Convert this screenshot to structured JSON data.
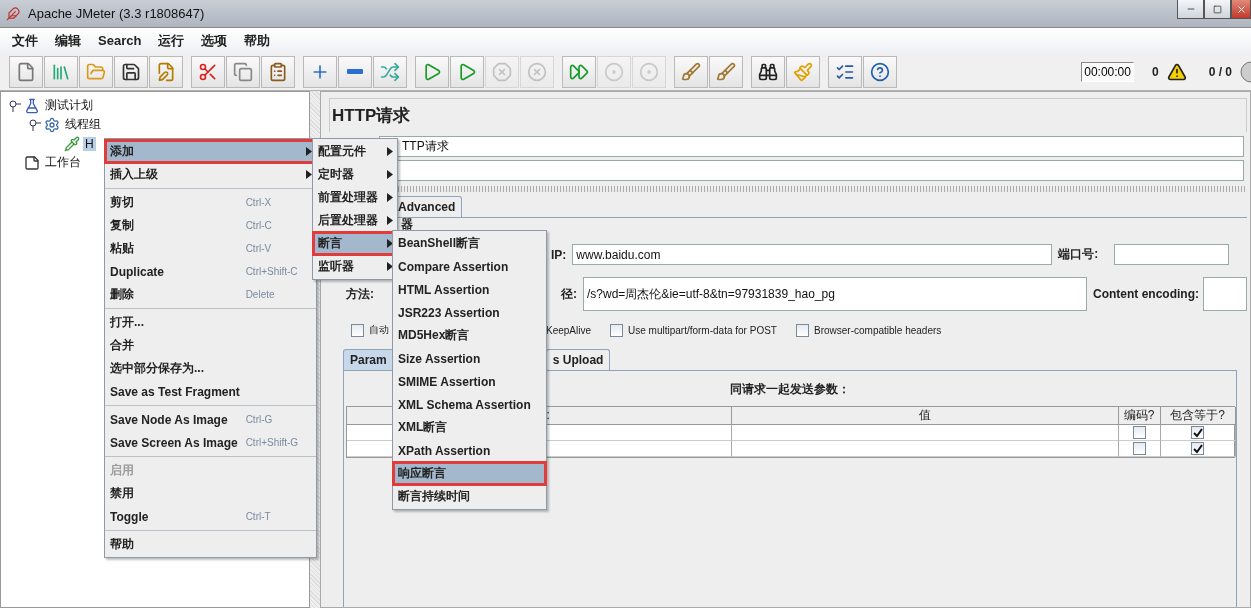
{
  "window": {
    "title": "Apache JMeter (3.3 r1808647)"
  },
  "menu_bar": [
    "文件",
    "编辑",
    "Search",
    "运行",
    "选项",
    "帮助"
  ],
  "toolbar_groups": [
    [
      {
        "kind": "new",
        "disabled": false
      },
      {
        "kind": "templates",
        "disabled": false
      },
      {
        "kind": "open",
        "disabled": false
      },
      {
        "kind": "save",
        "disabled": false
      },
      {
        "kind": "save-as",
        "disabled": false
      }
    ],
    [
      {
        "kind": "cut",
        "disabled": false
      },
      {
        "kind": "copy",
        "disabled": false
      },
      {
        "kind": "paste",
        "disabled": false
      }
    ],
    [
      {
        "kind": "expand",
        "disabled": false
      },
      {
        "kind": "collapse",
        "disabled": false
      },
      {
        "kind": "toggle",
        "disabled": false
      }
    ],
    [
      {
        "kind": "start",
        "disabled": false
      },
      {
        "kind": "start-no-pause",
        "disabled": false
      },
      {
        "kind": "stop",
        "disabled": true
      },
      {
        "kind": "shutdown",
        "disabled": true
      }
    ],
    [
      {
        "kind": "remote-start",
        "disabled": false
      },
      {
        "kind": "remote-stop",
        "disabled": true
      },
      {
        "kind": "remote-exit",
        "disabled": true
      }
    ],
    [
      {
        "kind": "clear",
        "disabled": false
      },
      {
        "kind": "clear-all",
        "disabled": false
      }
    ],
    [
      {
        "kind": "search",
        "disabled": false
      },
      {
        "kind": "reset-search",
        "disabled": false
      }
    ],
    [
      {
        "kind": "functions",
        "disabled": false
      },
      {
        "kind": "help",
        "disabled": false
      }
    ]
  ],
  "status": {
    "timer": "00:00:00",
    "errors": "0",
    "threads": "0 / 0"
  },
  "tree": [
    {
      "label": "测试计划",
      "kind": "plan",
      "expanded": true,
      "selected": false,
      "children": [
        {
          "label": "线程组",
          "kind": "thread-group",
          "expanded": true,
          "selected": false,
          "children": [
            {
              "label": "H",
              "kind": "sampler",
              "selected": true
            }
          ]
        }
      ]
    },
    {
      "label": "工作台",
      "kind": "workbench",
      "selected": false
    }
  ],
  "editor": {
    "title": "HTTP请求",
    "name_value": "TTP请求",
    "tabs": [
      {
        "label": "Advanced",
        "selected": false
      }
    ],
    "server_legend": "器",
    "server_label": "IP:",
    "server_value": "www.baidu.com",
    "port_label": "端口号:",
    "method_label": "方法:",
    "path_label": "径:",
    "path_value": "/s?wd=周杰伦&ie=utf-8&tn=97931839_hao_pg",
    "encoding_label": "Content encoding:",
    "options": [
      {
        "kind": "checkbox",
        "label": "自动",
        "checked": false
      },
      {
        "kind": "text",
        "label": "KeepAlive"
      },
      {
        "kind": "checkbox",
        "label": "Use multipart/form-data for POST",
        "checked": false
      },
      {
        "kind": "checkbox",
        "label": "Browser-compatible headers",
        "checked": false
      }
    ],
    "param_tabs": [
      {
        "label": "Param",
        "selected": true
      },
      {
        "label": "s Upload",
        "selected": false
      }
    ],
    "params_caption": "同请求一起发送参数：",
    "columns": [
      ":",
      "值",
      "编码?",
      "包含等于?"
    ],
    "rows": [
      {
        "encode": false,
        "include_equals": true
      },
      {
        "encode": false,
        "include_equals": true
      }
    ]
  },
  "context_menu": [
    {
      "kind": "item",
      "label": "添加",
      "submenu": true,
      "selected": true,
      "disabled": false
    },
    {
      "kind": "item",
      "label": "插入上级",
      "submenu": true,
      "selected": false,
      "disabled": false
    },
    {
      "kind": "separator"
    },
    {
      "kind": "item",
      "label": "剪切",
      "shortcut": "Ctrl-X",
      "selected": false,
      "disabled": false
    },
    {
      "kind": "item",
      "label": "复制",
      "shortcut": "Ctrl-C",
      "selected": false,
      "disabled": false
    },
    {
      "kind": "item",
      "label": "粘贴",
      "shortcut": "Ctrl-V",
      "selected": false,
      "disabled": false
    },
    {
      "kind": "item",
      "label": "Duplicate",
      "shortcut": "Ctrl+Shift-C",
      "selected": false,
      "disabled": false
    },
    {
      "kind": "item",
      "label": "删除",
      "shortcut": "Delete",
      "selected": false,
      "disabled": false
    },
    {
      "kind": "separator"
    },
    {
      "kind": "item",
      "label": "打开...",
      "selected": false,
      "disabled": false
    },
    {
      "kind": "item",
      "label": "合并",
      "selected": false,
      "disabled": false
    },
    {
      "kind": "item",
      "label": "选中部分保存为...",
      "selected": false,
      "disabled": false
    },
    {
      "kind": "item",
      "label": "Save as Test Fragment",
      "selected": false,
      "disabled": false
    },
    {
      "kind": "separator"
    },
    {
      "kind": "item",
      "label": "Save Node As Image",
      "shortcut": "Ctrl-G",
      "selected": false,
      "disabled": false
    },
    {
      "kind": "item",
      "label": "Save Screen As Image",
      "shortcut": "Ctrl+Shift-G",
      "selected": false,
      "disabled": false
    },
    {
      "kind": "separator"
    },
    {
      "kind": "item",
      "label": "启用",
      "selected": false,
      "disabled": true
    },
    {
      "kind": "item",
      "label": "禁用",
      "selected": false,
      "disabled": false
    },
    {
      "kind": "item",
      "label": "Toggle",
      "shortcut": "Ctrl-T",
      "selected": false,
      "disabled": false
    },
    {
      "kind": "separator"
    },
    {
      "kind": "item",
      "label": "帮助",
      "selected": false,
      "disabled": false
    }
  ],
  "add_submenu": [
    {
      "kind": "item",
      "label": "配置元件",
      "submenu": true,
      "selected": false,
      "disabled": false
    },
    {
      "kind": "item",
      "label": "定时器",
      "submenu": true,
      "selected": false,
      "disabled": false
    },
    {
      "kind": "item",
      "label": "前置处理器",
      "submenu": true,
      "selected": false,
      "disabled": false
    },
    {
      "kind": "item",
      "label": "后置处理器",
      "submenu": true,
      "selected": false,
      "disabled": false
    },
    {
      "kind": "item",
      "label": "断言",
      "submenu": true,
      "selected": true,
      "disabled": false
    },
    {
      "kind": "item",
      "label": "监听器",
      "submenu": true,
      "selected": false,
      "disabled": false
    }
  ],
  "assertion_submenu": [
    {
      "kind": "item",
      "label": "BeanShell断言",
      "selected": false,
      "disabled": false
    },
    {
      "kind": "item",
      "label": "Compare Assertion",
      "selected": false,
      "disabled": false
    },
    {
      "kind": "item",
      "label": "HTML Assertion",
      "selected": false,
      "disabled": false
    },
    {
      "kind": "item",
      "label": "JSR223 Assertion",
      "selected": false,
      "disabled": false
    },
    {
      "kind": "item",
      "label": "MD5Hex断言",
      "selected": false,
      "disabled": false
    },
    {
      "kind": "item",
      "label": "Size Assertion",
      "selected": false,
      "disabled": false
    },
    {
      "kind": "item",
      "label": "SMIME Assertion",
      "selected": false,
      "disabled": false
    },
    {
      "kind": "item",
      "label": "XML Schema Assertion",
      "selected": false,
      "disabled": false
    },
    {
      "kind": "item",
      "label": "XML断言",
      "selected": false,
      "disabled": false
    },
    {
      "kind": "item",
      "label": "XPath Assertion",
      "selected": false,
      "disabled": false
    },
    {
      "kind": "item",
      "label": "响应断言",
      "selected": true,
      "disabled": false
    },
    {
      "kind": "item",
      "label": "断言持续时间",
      "selected": false,
      "disabled": false
    }
  ]
}
